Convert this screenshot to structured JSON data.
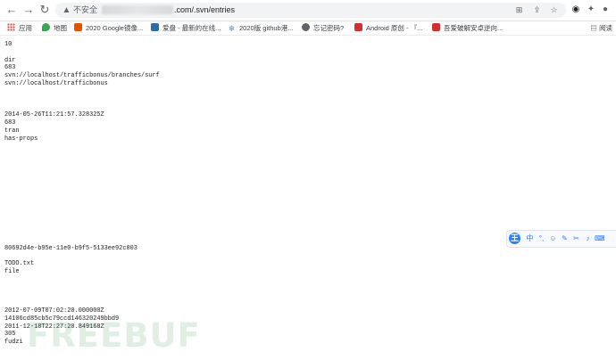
{
  "browser": {
    "back_icon": "back-arrow-icon",
    "forward_icon": "forward-arrow-icon",
    "reload_icon": "reload-icon",
    "security_label": "不安全",
    "url_host": ".com",
    "url_path": ".com/.svn/entries",
    "translate_icon": "translate-icon",
    "share_icon": "share-icon",
    "bookmark_icon": "star-icon",
    "extensions": [
      "record-icon",
      "puzzle-icon",
      "profile-icon",
      "menu-kebab-icon"
    ]
  },
  "bookmarks": {
    "items": [
      {
        "label": "应用",
        "icon": "apps-grid-icon"
      },
      {
        "label": "地图",
        "icon": "maps-pin-icon"
      },
      {
        "label": "2020 Google镜像...",
        "icon": "favicon-icon"
      },
      {
        "label": "爱盘 - 最新的在线...",
        "icon": "favicon-icon"
      },
      {
        "label": "2020版 github港...",
        "icon": "snowflake-icon"
      },
      {
        "label": "忘记密码?",
        "icon": "globe-icon"
      },
      {
        "label": "Android 原创 - 『...",
        "icon": "favicon-icon"
      },
      {
        "label": "吾爱破解安卓逆向...",
        "icon": "favicon-icon"
      }
    ],
    "reading_list": "阅读"
  },
  "content": {
    "lines": [
      "10",
      "",
      "dir",
      "683",
      "svn://localhost/trafficbonus/branches/surf",
      "svn://localhost/trafficbonus",
      "",
      "",
      "",
      "2014-05-26T11:21:57.328325Z",
      "683",
      "tran",
      "has-props",
      "",
      "",
      "",
      "",
      "",
      "",
      "",
      "",
      "",
      "",
      "",
      "",
      "",
      "80692d4e-b95e-11e0-b9f5-5133ee92c003",
      "",
      "TODO.txt",
      "file",
      "",
      "",
      "",
      "",
      "2012-07-09T07:02:20.000000Z",
      "14106cd85cb5c79ccd146320249bbd9",
      "2011-12-18T22:27:20.849168Z",
      "305",
      "fudzi"
    ]
  },
  "ime": {
    "logo": "王",
    "items": [
      {
        "glyph": "中",
        "icon": "chinese-mode-icon"
      },
      {
        "glyph": "°,",
        "icon": "punctuation-icon"
      },
      {
        "glyph": "☺",
        "icon": "emoji-icon"
      },
      {
        "glyph": "✎",
        "icon": "handwriting-icon"
      },
      {
        "glyph": "✂",
        "icon": "screenshot-icon"
      },
      {
        "glyph": "♪",
        "icon": "voice-icon"
      },
      {
        "glyph": "⌨",
        "icon": "keyboard-icon"
      }
    ]
  },
  "watermark": {
    "text": "FREEBUF"
  }
}
